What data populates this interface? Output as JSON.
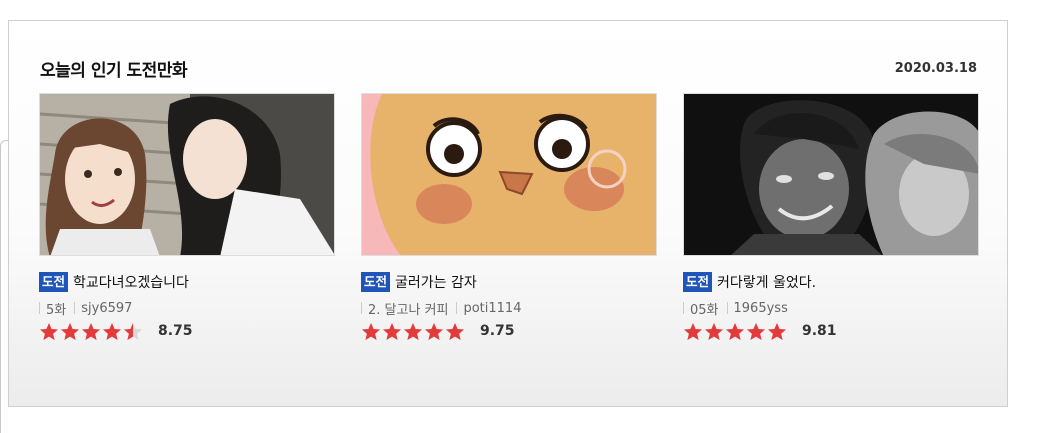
{
  "widget": {
    "title": "오늘의 인기 도전만화",
    "date": "2020.03.18"
  },
  "colors": {
    "badge": "#1f55b8",
    "star": "#e33b3b",
    "star_empty": "#d8d8d8"
  },
  "cards": [
    {
      "badge": "도전",
      "title": "학교다녀오겠습니다",
      "episode": "5화",
      "author": "sjy6597",
      "score": "8.75",
      "stars": 4.5,
      "thumb_icon": "two-girls-illustration"
    },
    {
      "badge": "도전",
      "title": "굴러가는 감자",
      "episode": "2. 달고나 커피",
      "author": "poti1114",
      "score": "9.75",
      "stars": 5,
      "thumb_icon": "potato-face-illustration"
    },
    {
      "badge": "도전",
      "title": "커다랗게 울었다.",
      "episode": "05화",
      "author": "1965yss",
      "score": "9.81",
      "stars": 5,
      "thumb_icon": "dark-crying-boy-illustration"
    }
  ]
}
